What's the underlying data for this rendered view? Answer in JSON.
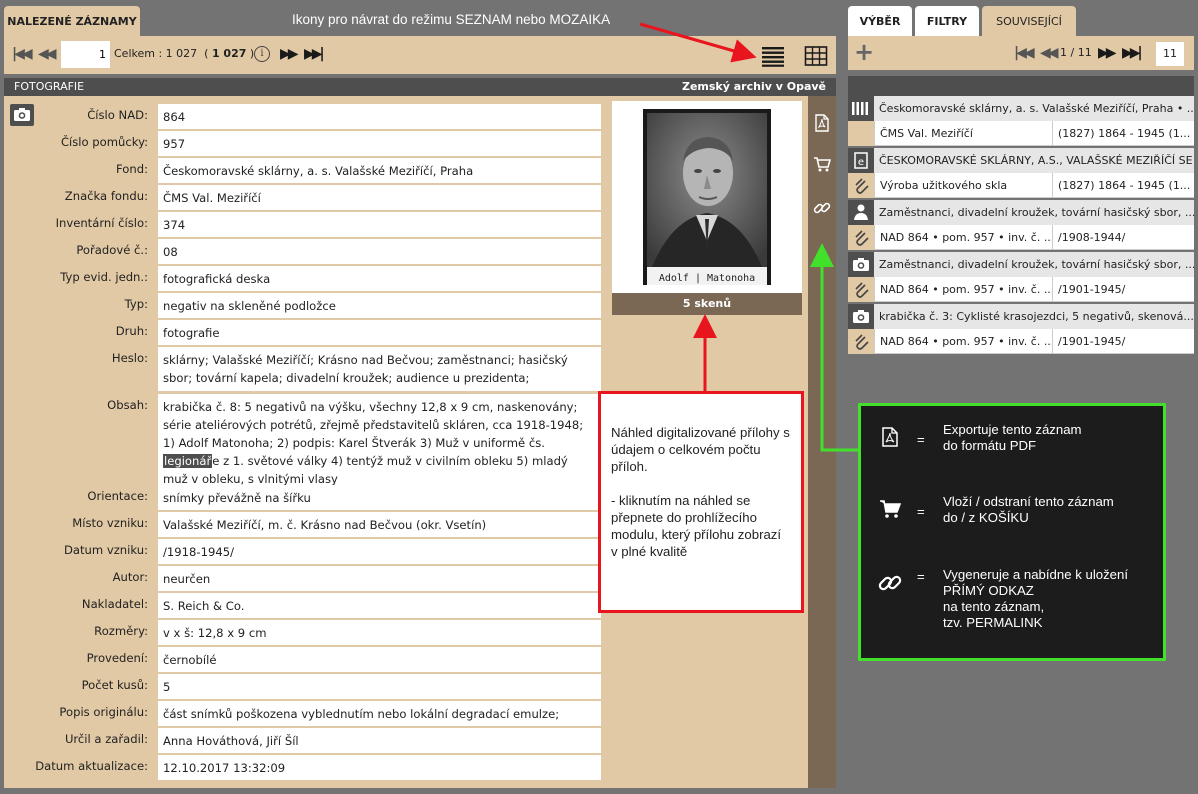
{
  "left_panel": {
    "tab_label": "NALEZENÉ ZÁZNAMY",
    "annotation_top": "Ikony pro návrat do režimu SEZNAM nebo MOZAIKA",
    "pager": {
      "current_page": "1",
      "total_label": "Celkem : 1 027",
      "total_paren_open": "(",
      "total_bold": "1 027",
      "total_paren_close": ")"
    },
    "header": {
      "left": "FOTOGRAFIE",
      "right": "Zemský archiv v Opavě"
    },
    "fields": [
      {
        "label": "Číslo NAD:",
        "value": "864"
      },
      {
        "label": "Číslo pomůcky:",
        "value": "957"
      },
      {
        "label": "Fond:",
        "value": "Českomoravské sklárny, a. s. Valašské Meziříčí, Praha"
      },
      {
        "label": "Značka fondu:",
        "value": "ČMS Val. Meziříčí"
      },
      {
        "label": "Inventární číslo:",
        "value": "374"
      },
      {
        "label": "Pořadové č.:",
        "value": "08"
      },
      {
        "label": "Typ evid. jedn.:",
        "value": "fotografická deska"
      },
      {
        "label": "Typ:",
        "value": "negativ na skleněné podložce"
      },
      {
        "label": "Druh:",
        "value": "fotografie"
      },
      {
        "label": "Heslo:",
        "value": "sklárny; Valašské Meziříčí; Krásno nad Bečvou; zaměstnanci; hasičský sbor; tovární kapela; divadelní kroužek; audience u prezidenta;"
      },
      {
        "label": "Obsah:",
        "value_pre": "krabička č. 8: 5 negativů na výšku, všechny 12,8 x 9 cm, naskenovány; série ateliérových potrétů, zřejmě představitelů skláren, cca 1918-1948; 1) Adolf Matonoha; 2) podpis: Karel Štverák 3) Muž v uniformě čs. ",
        "value_highlight": "legionář",
        "value_post": "e z 1. světové války 4) tentýž muž v civilním obleku 5) mladý muž v obleku, s vlnitými vlasy"
      },
      {
        "label": "Orientace:",
        "value": "snímky převážně na šířku"
      },
      {
        "label": "Místo vzniku:",
        "value": "Valašské Meziříčí, m. č. Krásno nad Bečvou (okr. Vsetín)"
      },
      {
        "label": "Datum vzniku:",
        "value": "/1918-1945/"
      },
      {
        "label": "Autor:",
        "value": "neurčen"
      },
      {
        "label": "Nakladatel:",
        "value": "S. Reich & Co."
      },
      {
        "label": "Rozměry:",
        "value": "v x š: 12,8 x 9 cm"
      },
      {
        "label": "Provedení:",
        "value": "černobílé"
      },
      {
        "label": "Počet kusů:",
        "value": "5"
      },
      {
        "label": "Popis originálu:",
        "value": "část snímků poškozena vyblednutím nebo lokální degradací emulze;"
      },
      {
        "label": "Určil a zařadil:",
        "value": "Anna Hováthová, Jiří Šíl"
      },
      {
        "label": "Datum aktualizace:",
        "value": "12.10.2017 13:32:09"
      }
    ],
    "thumbnail": {
      "caption": "Adolf | Matonoha",
      "scan_count": "5 skenů"
    },
    "annotation_red": [
      "Náhled digitalizované přílohy s údajem o celkovém počtu příloh.",
      "- kliknutím na náhled se přepnete do prohlížecího modulu, který přílohu zobrazí v plné kvalitě"
    ]
  },
  "right_panel": {
    "tabs": [
      "VÝBĚR",
      "FILTRY",
      "SOUVISEJÍCÍ"
    ],
    "pager": {
      "current": "1 / 11",
      "page_box": "11"
    },
    "results": [
      {
        "icon": "archive-fond-icon",
        "title": "Českomoravské sklárny, a. s. Valašské Meziříčí, Praha • ...",
        "cell1": "ČMS Val. Meziříčí",
        "cell2": "(1827) 1864 - 1945 (1..."
      },
      {
        "icon": "finding-aid-icon",
        "title": "ČESKOMORAVSKÉ SKLÁRNY, A.S., VALAŠSKÉ MEZIŘÍČÍ SE ...",
        "cell1": "Výroba užitkového skla",
        "cell2": "(1827) 1864 - 1945 (1..."
      },
      {
        "icon": "person-icon",
        "title": "Zaměstnanci, divadelní kroužek, tovární hasičský sbor, ...",
        "cell1": "NAD 864 • pom. 957 • inv. č. ...",
        "cell2": "/1908-1944/"
      },
      {
        "icon": "camera-icon",
        "title": "Zaměstnanci, divadelní kroužek, tovární hasičský sbor, ...",
        "cell1": "NAD 864 • pom. 957 • inv. č. ...",
        "cell2": "/1901-1945/"
      },
      {
        "icon": "camera-icon",
        "title": "krabička č. 3: Cyklisté krasojezdci, 5 negativů, skenová...",
        "cell1": "NAD 864 • pom. 957 • inv. č. ...",
        "cell2": "/1901-1945/"
      }
    ],
    "legend": [
      {
        "icon": "pdf-icon",
        "eq": "=",
        "lines": [
          "Exportuje tento záznam",
          "do formátu PDF"
        ]
      },
      {
        "icon": "cart-icon",
        "eq": "=",
        "lines": [
          "Vloží / odstraní tento záznam",
          "do / z KOŠÍKU"
        ]
      },
      {
        "icon": "link-icon",
        "eq": "=",
        "lines": [
          "Vygeneruje a nabídne k uložení",
          "PŘÍMÝ ODKAZ",
          "na tento záznam,",
          "tzv. PERMALINK"
        ]
      }
    ]
  },
  "colors": {
    "panel_tan": "#e2c9a5",
    "header_dark": "#4e4e4e",
    "strip_brown": "#7a6854",
    "arrow_red": "#e8141e",
    "arrow_green": "#43e02b"
  }
}
